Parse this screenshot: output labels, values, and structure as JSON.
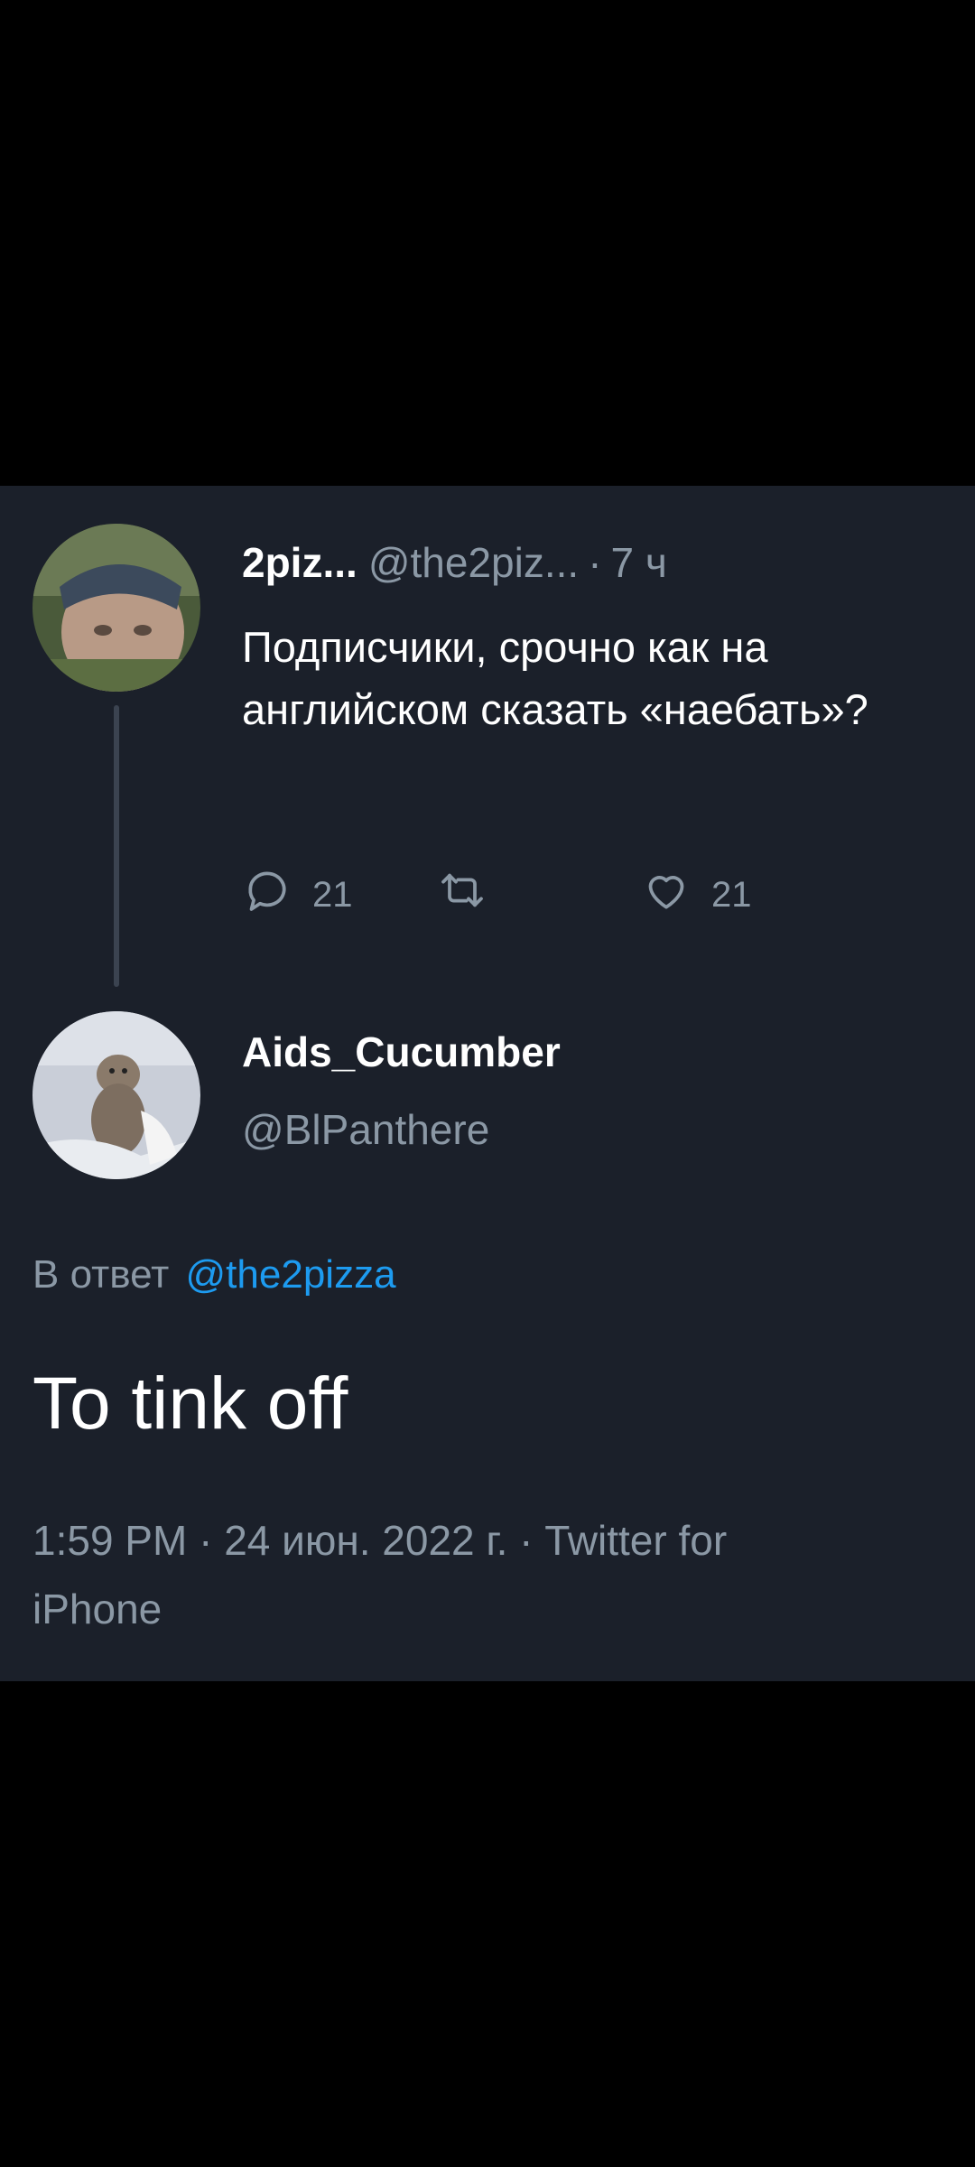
{
  "colors": {
    "background": "#000000",
    "card": "#1b202a",
    "text_primary": "#ffffff",
    "text_secondary": "#8b98a5",
    "link": "#1d9bf0",
    "thread_line": "#3b4350"
  },
  "original_tweet": {
    "name": "2piz...",
    "handle": "@the2piz...",
    "separator": "·",
    "time": "7 ч",
    "text": "Подписчики, срочно как на английском сказать «наебать»?",
    "actions": {
      "reply_icon": "reply-icon",
      "reply_count": "21",
      "retweet_icon": "retweet-icon",
      "like_icon": "heart-icon",
      "like_count": "21"
    }
  },
  "reply_tweet": {
    "name": "Aids_Cucumber",
    "handle": "@BlPanthere",
    "reply_to_label": "В ответ",
    "reply_to_mention": "@the2pizza",
    "text": "To tink off",
    "timestamp": "1:59 PM · 24 июн. 2022 г. · Twitter for iPhone"
  }
}
